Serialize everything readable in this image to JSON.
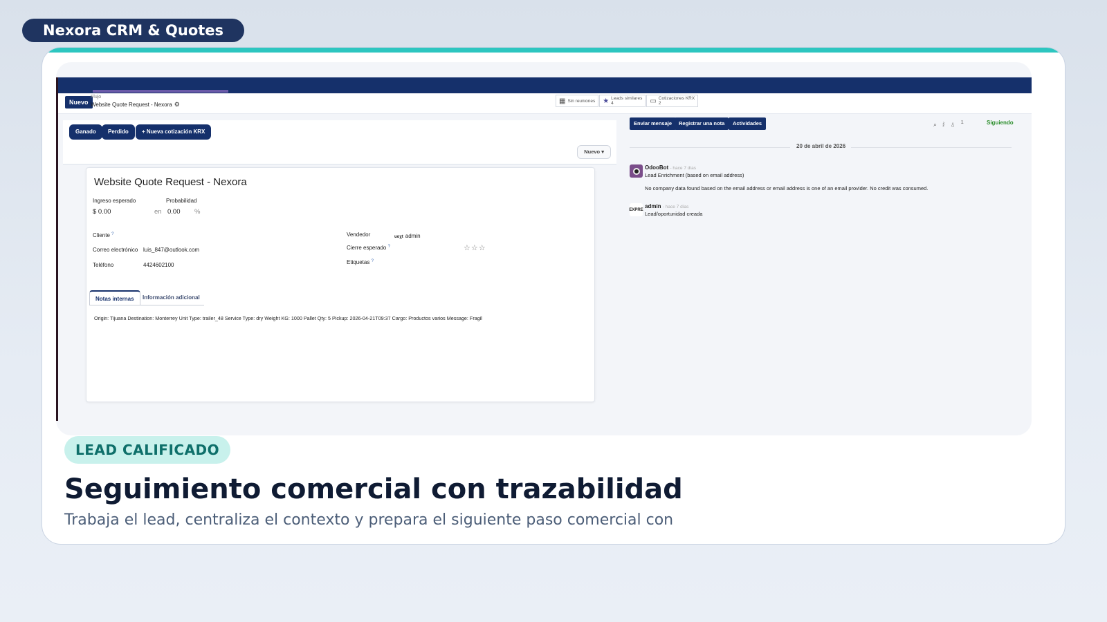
{
  "app_name": "Nexora CRM & Quotes",
  "colors": {
    "accent_teal": "#2dc6c0",
    "odoo_navy": "#15306b",
    "badge_bg": "#c8f1ec",
    "badge_text": "#0e6f6a",
    "following_green": "#2a8d2a"
  },
  "control": {
    "new_button": "Nuevo",
    "breadcrumb_parent": "Flujo",
    "breadcrumb_current": "Website Quote Request - Nexora",
    "smart_buttons": [
      {
        "icon": "calendar-icon",
        "label": "Sin reuniones",
        "count": ""
      },
      {
        "icon": "star-icon",
        "label": "Leads similares",
        "count": "4"
      },
      {
        "icon": "money-icon",
        "label": "Cotizaciones KRX",
        "count": "2"
      }
    ]
  },
  "actions": {
    "won": "Ganado",
    "lost": "Perdido",
    "new_quote": "+ Nueva cotización KRX",
    "stage": "Nuevo ▾"
  },
  "form": {
    "title": "Website Quote Request - Nexora",
    "expected_revenue_label": "Ingreso esperado",
    "expected_revenue_value": "$ 0.00",
    "probability_label": "Probabilidad",
    "probability_prefix": "en",
    "probability_value": "0.00",
    "probability_unit": "%",
    "customer_label": "Cliente",
    "email_label": "Correo electrónico",
    "email_value": "luis_847@outlook.com",
    "phone_label": "Teléfono",
    "phone_value": "4424602100",
    "salesperson_label": "Vendedor",
    "salesperson_value": "admin",
    "salesperson_avatar_text": "uoχt",
    "expected_close_label": "Cierre esperado",
    "tags_label": "Etiquetas",
    "help_mark": "?",
    "priority_stars": 0,
    "priority_max": 3,
    "tabs": [
      "Notas internas",
      "Información adicional"
    ],
    "internal_notes": "Origin: Tijuana Destination: Monterrey Unit Type: trailer_48 Service Type: dry Weight KG: 1000 Pallet Qty: 5 Pickup: 2026-04-21T09:37 Cargo: Productos varios Message: Fragil"
  },
  "chatter": {
    "send_message": "Enviar mensaje",
    "log_note": "Registrar una nota",
    "activities": "Actividades",
    "followers_count": "1",
    "following": "Siguiendo",
    "date_separator": "20 de abril de 2026",
    "messages": [
      {
        "author": "OdooBot",
        "time": "- hace 7 días",
        "lines": [
          "Lead Enrichment (based on email address)",
          "No company data found based on the email address or email address is one of an email provider. No credit was consumed."
        ]
      },
      {
        "author": "admin",
        "time": "- hace 7 días",
        "avatar_text": "EXPRE",
        "lines": [
          "Lead/oportunidad creada"
        ]
      }
    ]
  },
  "badge": "LEAD CALIFICADO",
  "headline": "Seguimiento comercial con trazabilidad",
  "subline": "Trabaja el lead, centraliza el contexto y prepara el siguiente paso comercial con"
}
